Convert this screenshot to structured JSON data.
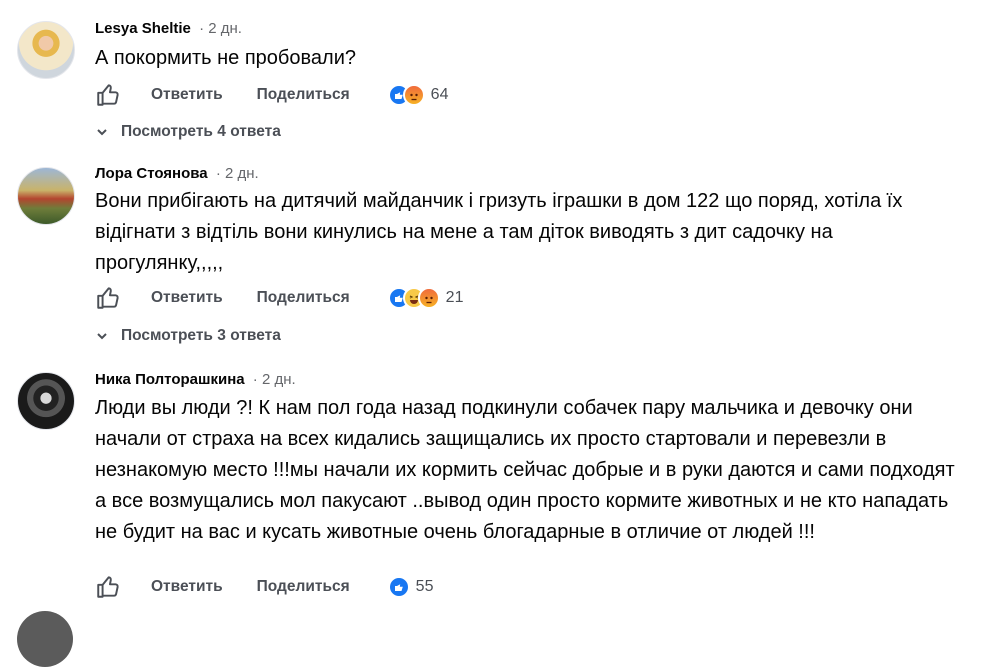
{
  "comments": [
    {
      "author": "Lesya Sheltie",
      "time": "· 2 дн.",
      "text": "А покормить не пробовали?",
      "reply_label": "Ответить",
      "share_label": "Поделиться",
      "reactions": [
        "like",
        "angry"
      ],
      "reaction_count": "64",
      "replies_label": "Посмотреть 4 ответа"
    },
    {
      "author": "Лора Стоянова",
      "time": "· 2 дн.",
      "text": "Вони прибігають на дитячий майданчик і гризуть іграшки в дом 122 що поряд, хотіла їх відігнати з відтіль вони кинулись на мене а там діток виводять з дит садочку на прогулянку,,,,,",
      "reply_label": "Ответить",
      "share_label": "Поделиться",
      "reactions": [
        "like",
        "haha",
        "angry"
      ],
      "reaction_count": "21",
      "replies_label": "Посмотреть 3 ответа"
    },
    {
      "author": "Ника Полторашкина",
      "time": "· 2 дн.",
      "text": "Люди вы люди ?! К нам пол года назад подкинули собачек пару мальчика и девочку они начали от страха на всех кидались защищались их просто стартовали и перевезли в незнакомую место !!!мы начали их кормить сейчас добрые и в руки даются и сами подходят а все возмущались мол пакусают ..вывод один просто кормите животных и не кто нападать не будит на вас и кусать животные очень блогадарные в отличие от людей !!!",
      "reply_label": "Ответить",
      "share_label": "Поделиться",
      "reactions": [
        "like"
      ],
      "reaction_count": "55"
    }
  ],
  "colors": {
    "like_blue": "#1877f2",
    "secondary_text": "#65676b",
    "action_text": "#4b4f56"
  },
  "icons": [
    "thumbs-up-outline-icon",
    "chevron-down-icon",
    "like-reaction-icon",
    "angry-reaction-icon",
    "haha-reaction-icon"
  ]
}
